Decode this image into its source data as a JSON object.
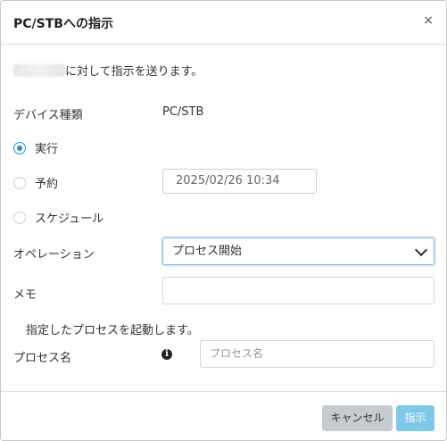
{
  "dialog": {
    "title": "PC/STBへの指示",
    "close_label": "×",
    "intro_suffix": "に対して指示を送ります。"
  },
  "device_type": {
    "label": "デバイス種類",
    "value": "PC/STB"
  },
  "modes": [
    {
      "label": "実行",
      "checked": true
    },
    {
      "label": "予約",
      "checked": false
    },
    {
      "label": "スケジュール",
      "checked": false
    }
  ],
  "reservation_datetime": "2025/02/26  10:34",
  "operation": {
    "label": "オペレーション",
    "selected": "プロセス開始"
  },
  "memo": {
    "label": "メモ",
    "value": ""
  },
  "operation_description": "指定したプロセスを起動します。",
  "process_name": {
    "label": "プロセス名",
    "placeholder": "プロセス名",
    "info_icon": "i"
  },
  "footer": {
    "cancel_label": "キャンセル",
    "send_label": "指示"
  },
  "colors": {
    "accent": "#2d8cd9",
    "send_button": "#7ec8ea",
    "cancel_button": "#c6cbd0"
  }
}
